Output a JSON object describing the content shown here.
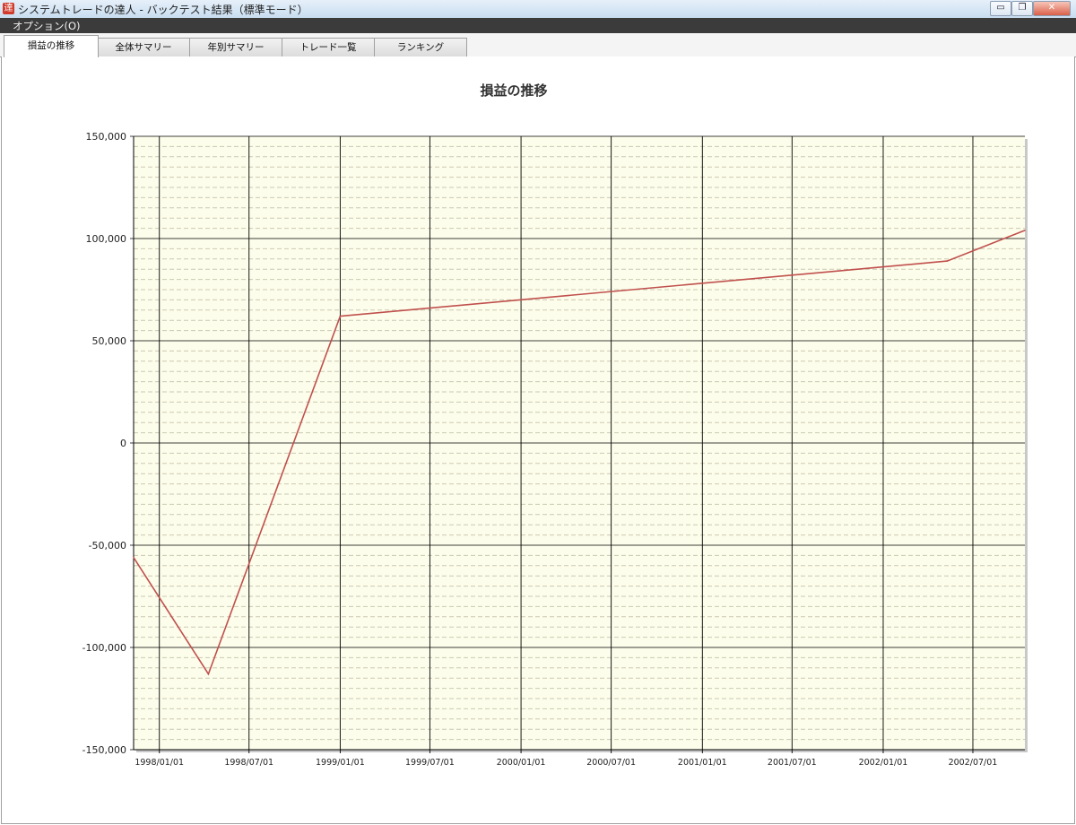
{
  "window": {
    "title": "システムトレードの達人 - バックテスト結果（標準モード）",
    "icon": "達",
    "buttons": {
      "minimize": "▭",
      "restore": "❐",
      "close": "✕"
    }
  },
  "menu": {
    "options": "オプション(O)"
  },
  "tabs": [
    "損益の推移",
    "全体サマリー",
    "年別サマリー",
    "トレード一覧",
    "ランキング"
  ],
  "colors": {
    "plot_background": "#fdfdeb",
    "line": "#c0504d",
    "grid_major": "#000000"
  },
  "chart_data": {
    "type": "line",
    "title": "損益の推移",
    "ylim": [
      -150000,
      150000
    ],
    "y_ticks": [
      "150,000",
      "100,000",
      "50,000",
      "0",
      "-50,000",
      "-100,000",
      "-150,000"
    ],
    "y_tick_values": [
      150000,
      100000,
      50000,
      0,
      -50000,
      -100000,
      -150000
    ],
    "x_range": [
      "1997-11-10",
      "2002-10-14"
    ],
    "x_ticks": [
      "1998/01/01",
      "1998/07/01",
      "1999/01/01",
      "1999/07/01",
      "2000/01/01",
      "2000/07/01",
      "2001/01/01",
      "2001/07/01",
      "2002/01/01",
      "2002/07/01"
    ],
    "x_tick_dates": [
      "1998-01-01",
      "1998-07-01",
      "1999-01-01",
      "1999-07-01",
      "2000-01-01",
      "2000-07-01",
      "2001-01-01",
      "2001-07-01",
      "2002-01-01",
      "2002-07-01"
    ],
    "grid": true,
    "series": [
      {
        "x": [
          "1997-11-10",
          "1998-04-10",
          "1999-01-01",
          "2002-05-10",
          "2002-10-14"
        ],
        "y": [
          -56000,
          -113000,
          62000,
          89000,
          104000
        ]
      }
    ]
  }
}
